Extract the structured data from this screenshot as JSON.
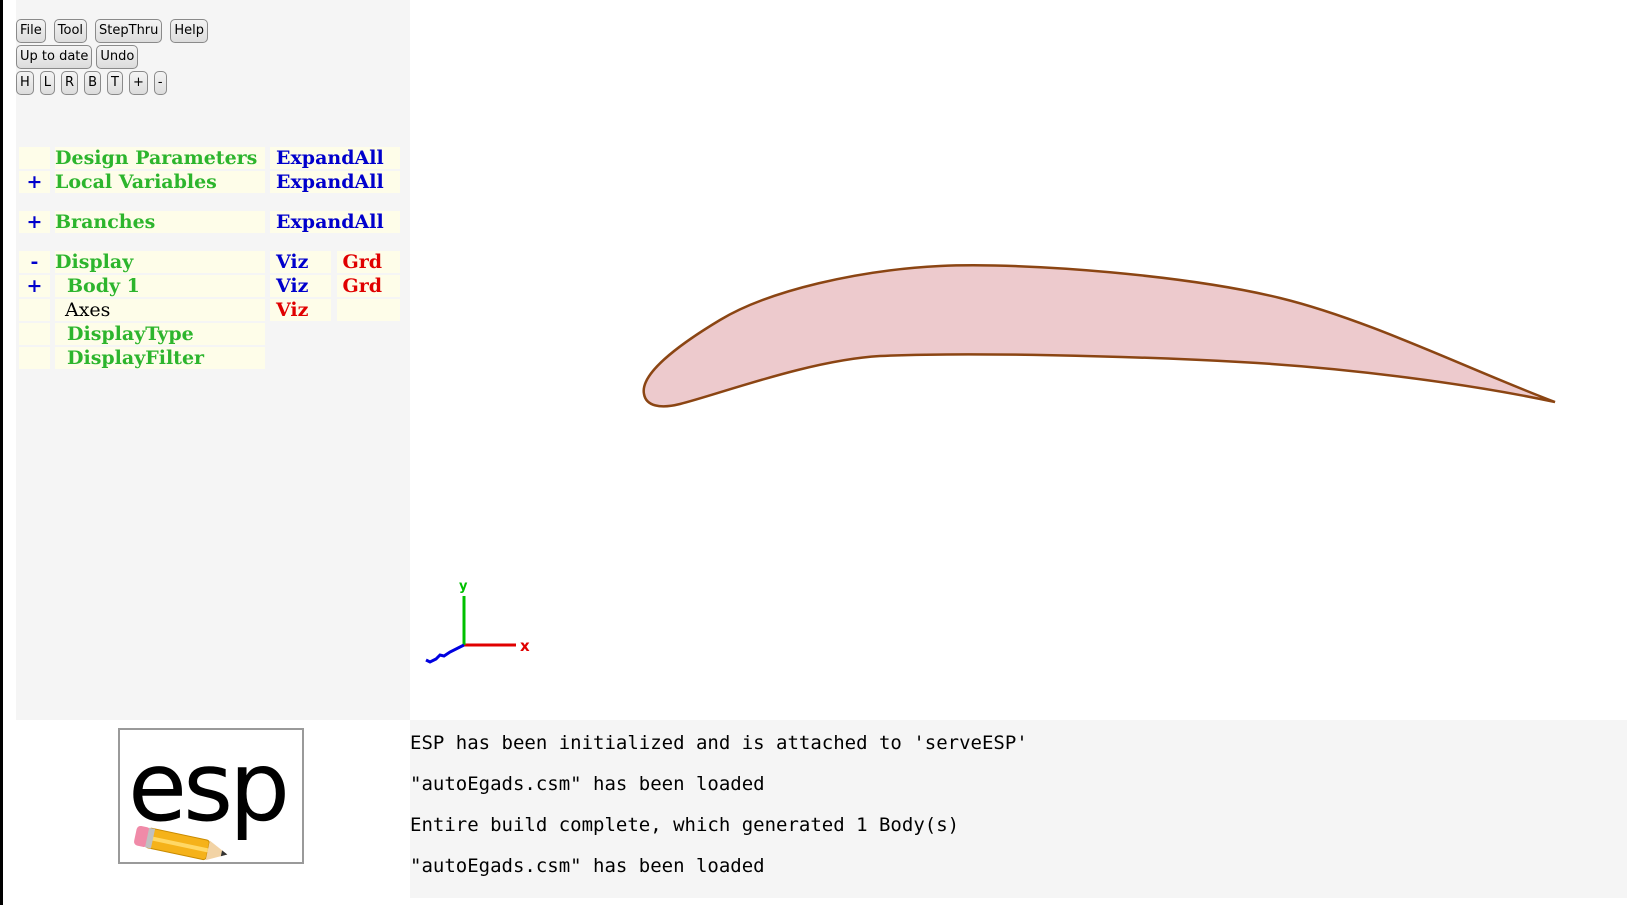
{
  "toolbar": {
    "row1": [
      "File",
      "Tool",
      "StepThru",
      "Help"
    ],
    "row2": [
      "Up to date",
      "Undo"
    ],
    "row3": [
      "H",
      "L",
      "R",
      "B",
      "T",
      "+",
      "-"
    ]
  },
  "tree": {
    "design_parameters": {
      "toggle": "",
      "label": "Design Parameters",
      "action": "ExpandAll"
    },
    "local_variables": {
      "toggle": "+",
      "label": "Local Variables",
      "action": "ExpandAll"
    },
    "branches": {
      "toggle": "+",
      "label": "Branches",
      "action": "ExpandAll"
    },
    "display": {
      "toggle": "-",
      "label": "Display",
      "viz": "Viz",
      "grd": "Grd"
    },
    "body1": {
      "toggle": "+",
      "label": "Body 1",
      "viz": "Viz",
      "grd": "Grd"
    },
    "axes": {
      "label": "Axes",
      "viz": "Viz"
    },
    "display_type": {
      "label": "DisplayType"
    },
    "display_filter": {
      "label": "DisplayFilter"
    }
  },
  "viewport": {
    "axes_labels": {
      "x": "x",
      "y": "y"
    },
    "colors": {
      "fill": "#edcacd",
      "edge": "#8b4513",
      "x_axis": "#e00000",
      "y_axis": "#00c000",
      "z_axis": "#0000e0"
    }
  },
  "logo": {
    "text": "esp",
    "icon": "pencil-icon"
  },
  "messages": [
    "ESP has been initialized and is attached to 'serveESP'",
    "\"autoEgads.csm\" has been loaded",
    "Entire build complete, which generated 1 Body(s)",
    "\"autoEgads.csm\" has been loaded"
  ]
}
